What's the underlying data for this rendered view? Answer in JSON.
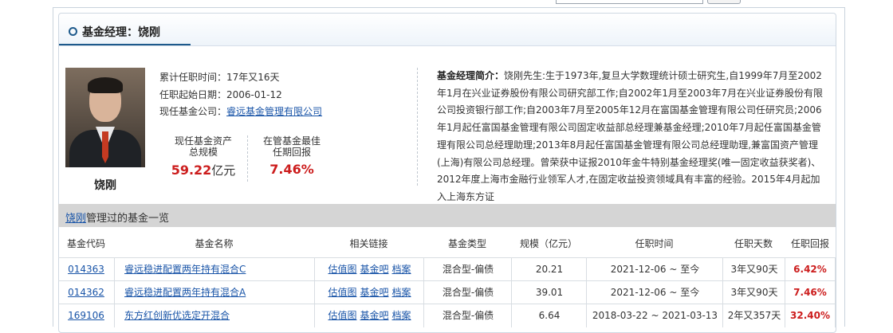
{
  "section_title": "基金经理：饶刚",
  "manager": {
    "name": "饶刚",
    "tenure_label": "累计任职时间：",
    "tenure": "17年又16天",
    "start_label": "任职起始日期：",
    "start_date": "2006-01-12",
    "company_label": "现任基金公司：",
    "company": "睿远基金管理有限公司"
  },
  "stats": {
    "assets_label_1": "现任基金资产",
    "assets_label_2": "总规模",
    "assets_value": "59.22",
    "assets_unit": "亿元",
    "best_label_1": "在管基金最佳",
    "best_label_2": "任期回报",
    "best_value": "7.46%"
  },
  "bio": {
    "label": "基金经理简介：",
    "text": "饶刚先生:生于1973年,复旦大学数理统计硕士研究生,自1999年7月至2002年1月在兴业证券股份有限公司研究部工作;自2002年1月至2003年7月在兴业证券股份有限公司投资银行部工作;自2003年7月至2005年12月在富国基金管理有限公司任研究员;2006年1月起任富国基金管理有限公司固定收益部总经理兼基金经理;2010年7月起任富国基金管理有限公司总经理助理;2013年8月起任富国基金管理有限公司总经理助理,兼富国资产管理(上海)有限公司总经理。曾荣获中证报2010年金牛特别基金经理奖(唯一固定收益获奖者)、2012年度上海市金融行业领军人才,在固定收益投资领域具有丰富的经验。2015年4月起加入上海东方证"
  },
  "list": {
    "name_link": "饶刚",
    "title_suffix": "管理过的基金一览",
    "columns": [
      "基金代码",
      "基金名称",
      "相关链接",
      "基金类型",
      "规模（亿元）",
      "任职时间",
      "任职天数",
      "任职回报"
    ],
    "link_labels": [
      "估值图",
      "基金吧",
      "档案"
    ],
    "rows": [
      {
        "code": "014363",
        "name": "睿远稳进配置两年持有混合C",
        "type": "混合型-偏债",
        "size": "20.21",
        "period": "2021-12-06 ~ 至今",
        "days": "3年又90天",
        "return": "6.42%"
      },
      {
        "code": "014362",
        "name": "睿远稳进配置两年持有混合A",
        "type": "混合型-偏债",
        "size": "39.01",
        "period": "2021-12-06 ~ 至今",
        "days": "3年又90天",
        "return": "7.46%"
      },
      {
        "code": "169106",
        "name": "东方红创新优选定开混合",
        "type": "混合型-偏债",
        "size": "6.64",
        "period": "2018-03-22 ~ 2021-03-13",
        "days": "2年又357天",
        "return": "32.40%"
      }
    ]
  }
}
